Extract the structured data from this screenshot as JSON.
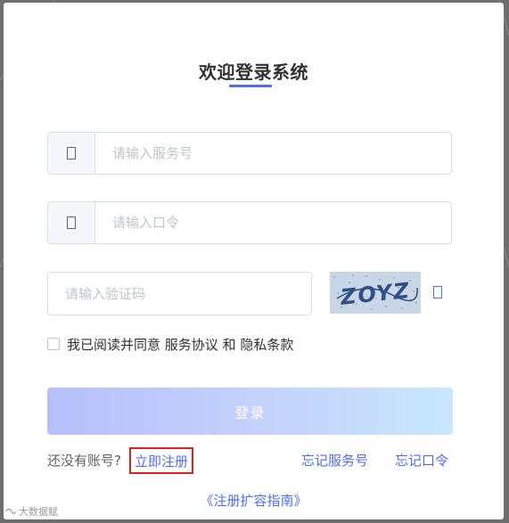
{
  "title": "欢迎登录系统",
  "service_field": {
    "placeholder": "请输入服务号",
    "prepend_icon": "box-icon"
  },
  "password_field": {
    "placeholder": "请输入口令",
    "prepend_icon": "box-icon"
  },
  "captcha": {
    "placeholder": "请输入验证码",
    "image_text": "ZOYZ",
    "refresh_icon": "box-icon"
  },
  "agreement": {
    "prefix": "我已阅读并同意 ",
    "terms": "服务协议",
    "conj": " 和 ",
    "privacy": "隐私条款"
  },
  "login_button": "登录",
  "footer": {
    "no_account": "还没有账号?",
    "register": "立即注册",
    "forgot_service": "忘记服务号",
    "forgot_password": "忘记口令"
  },
  "guide": "《注册扩容指南》",
  "watermark": "大数据赋",
  "colors": {
    "accent": "#4e6ef2",
    "highlight_box": "#e0201f",
    "button_gradient_start": "#b7c0fb",
    "button_gradient_end": "#c7e7fd"
  }
}
